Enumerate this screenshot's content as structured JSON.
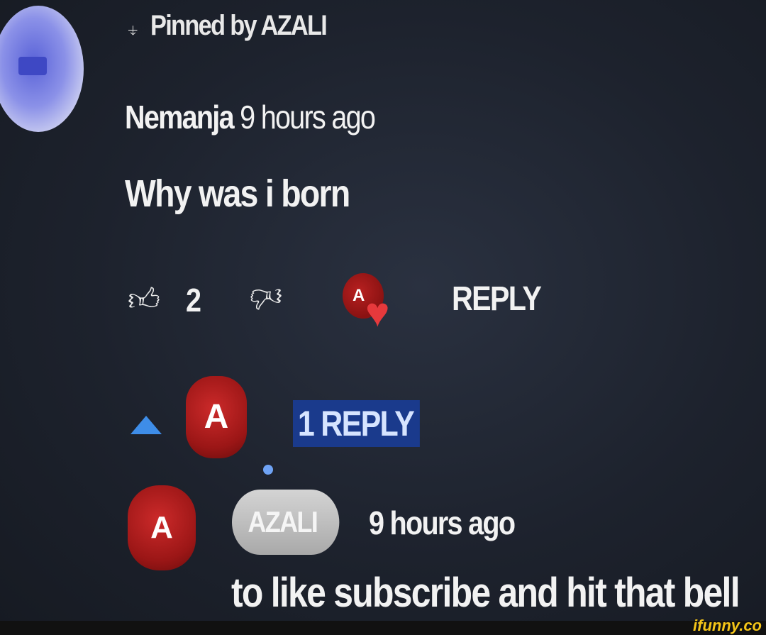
{
  "pinned_comment": {
    "pin_icon": "pin-icon",
    "pinned_label": "Pinned by AZALI",
    "author": "Nemanja",
    "timestamp": "9 hours ago",
    "body": "Why was i born",
    "like_count": "2",
    "reply_button": "REPLY",
    "heart_badge_letter": "A"
  },
  "replies": {
    "toggle_label": "1 REPLY",
    "avatar_letter": "A",
    "reply": {
      "avatar_letter": "A",
      "author_chip": "AZALI",
      "timestamp": "9 hours ago",
      "body": "to like subscribe and hit that bell"
    }
  },
  "watermark": "ifunny.co",
  "colors": {
    "background": "#1d222d",
    "accent_blue": "#3e8de8",
    "reply_highlight": "#1a3a8c",
    "heart": "#e6393c",
    "avatar_red": "#9b1616",
    "watermark": "#f5c518"
  }
}
